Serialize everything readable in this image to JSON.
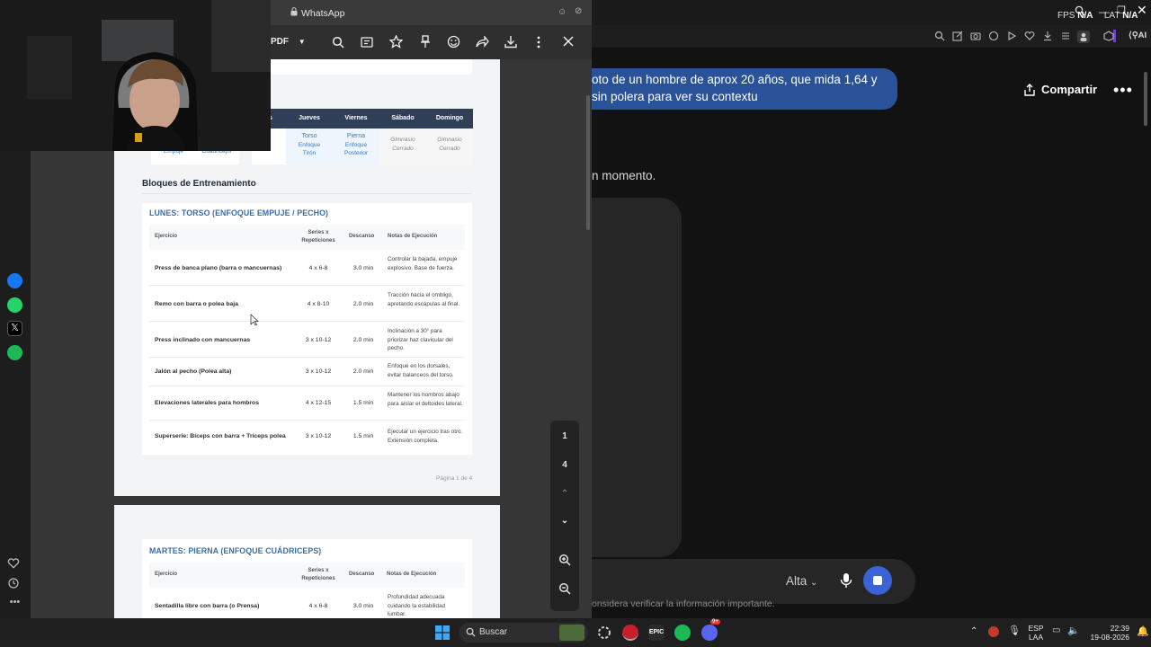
{
  "whatsapp_window": {
    "title": "WhatsApp",
    "toolbar_file_label": "PDF",
    "icons": [
      "search-icon",
      "text-select-icon",
      "star-icon",
      "pin-icon",
      "emoji-icon",
      "share-icon",
      "download-icon",
      "more-vertical-icon",
      "close-icon"
    ]
  },
  "pdf": {
    "schedule": {
      "days": [
        "s",
        "Jueves",
        "Viernes",
        "Sábado",
        "Domingo"
      ],
      "partial_left": [
        "Empuje",
        "Cuádriceps"
      ],
      "cells": [
        {
          "lines": [
            "Torso",
            "Enfoque",
            "Tirón"
          ],
          "style": "blue"
        },
        {
          "lines": [
            "Pierna",
            "Enfoque",
            "Posterior"
          ],
          "style": "blue"
        },
        {
          "lines": [
            "Gimnasio",
            "Cerrado"
          ],
          "style": "grey"
        },
        {
          "lines": [
            "Gimnasio",
            "Cerrado"
          ],
          "style": "grey"
        }
      ]
    },
    "blocks_title": "Bloques de Entrenamiento",
    "monday": {
      "title": "LUNES: TORSO (ENFOQUE EMPUJE / PECHO)",
      "headers": {
        "exercise": "Ejercicio",
        "series": "Series x Repeticiones",
        "rest": "Descanso",
        "notes": "Notas de Ejecución"
      },
      "rows": [
        {
          "exercise": "Press de banca plano (barra o mancuernas)",
          "series": "4 x 6-8",
          "rest": "3.0 min",
          "notes": "Controlar la bajada, empuje explosivo. Base de fuerza."
        },
        {
          "exercise": "Remo con barra o polea baja",
          "series": "4 x 8-10",
          "rest": "2.0 min",
          "notes": "Tracción hacia el ombligo, apretando escápulas al final."
        },
        {
          "exercise": "Press inclinado con mancuernas",
          "series": "3 x 10-12",
          "rest": "2.0 min",
          "notes": "Inclinación a 30° para priorizar haz clavicular del pecho."
        },
        {
          "exercise": "Jalón al pecho (Polea alta)",
          "series": "3 x 10-12",
          "rest": "2.0 min",
          "notes": "Enfoque en los dorsales, evitar balanceos del torso."
        },
        {
          "exercise": "Elevaciones laterales para hombros",
          "series": "4 x 12-15",
          "rest": "1.5 min",
          "notes": "Mantener los hombros abajo para aislar el deltoides lateral."
        },
        {
          "exercise": "Superserie: Bíceps con barra + Tríceps polea",
          "series": "3 x 10-12",
          "rest": "1.5 min",
          "notes": "Ejecutar un ejercicio tras otro. Extensión completa."
        }
      ],
      "footer": "Página 1 de 4"
    },
    "tuesday": {
      "title": "MARTES: PIERNA (ENFOQUE CUÁDRICEPS)",
      "headers": {
        "exercise": "Ejercicio",
        "series": "Series x Repeticiones",
        "rest": "Descanso",
        "notes": "Notas de Ejecución"
      },
      "rows": [
        {
          "exercise": "Sentadilla libre con barra (o Prensa)",
          "series": "4 x 6-8",
          "rest": "3.0 min",
          "notes": "Profundidad adecuada cuidando la estabilidad lumbar."
        }
      ]
    },
    "page_nav": {
      "current": "1",
      "total": "4"
    }
  },
  "browser": {
    "overlay": {
      "fps_label": "FPS",
      "fps_value": "N/A",
      "lat_label": "LAT",
      "lat_value": "N/A"
    },
    "ai_label": "AI",
    "chat_message_line1": "oto de un hombre de aprox 20 años, que mida 1,64 y",
    "chat_message_line2": "sin polera para ver su contextu",
    "share_label": "Compartir",
    "more_label": "•••",
    "assistant_text": "n momento.",
    "model_label": "Alta",
    "disclaimer": "onsidera verificar la información importante."
  },
  "taskbar": {
    "search_placeholder": "Buscar",
    "language": "ESP",
    "language_sub": "LAA",
    "time": "22:39",
    "date": "19-08-2026",
    "discord_badge": "9+"
  },
  "colors": {
    "chat_bubble": "#2a5298",
    "schedule_header": "#2f3f57",
    "section_title": "#3a6ea5",
    "stop_button": "#3b63d6"
  }
}
